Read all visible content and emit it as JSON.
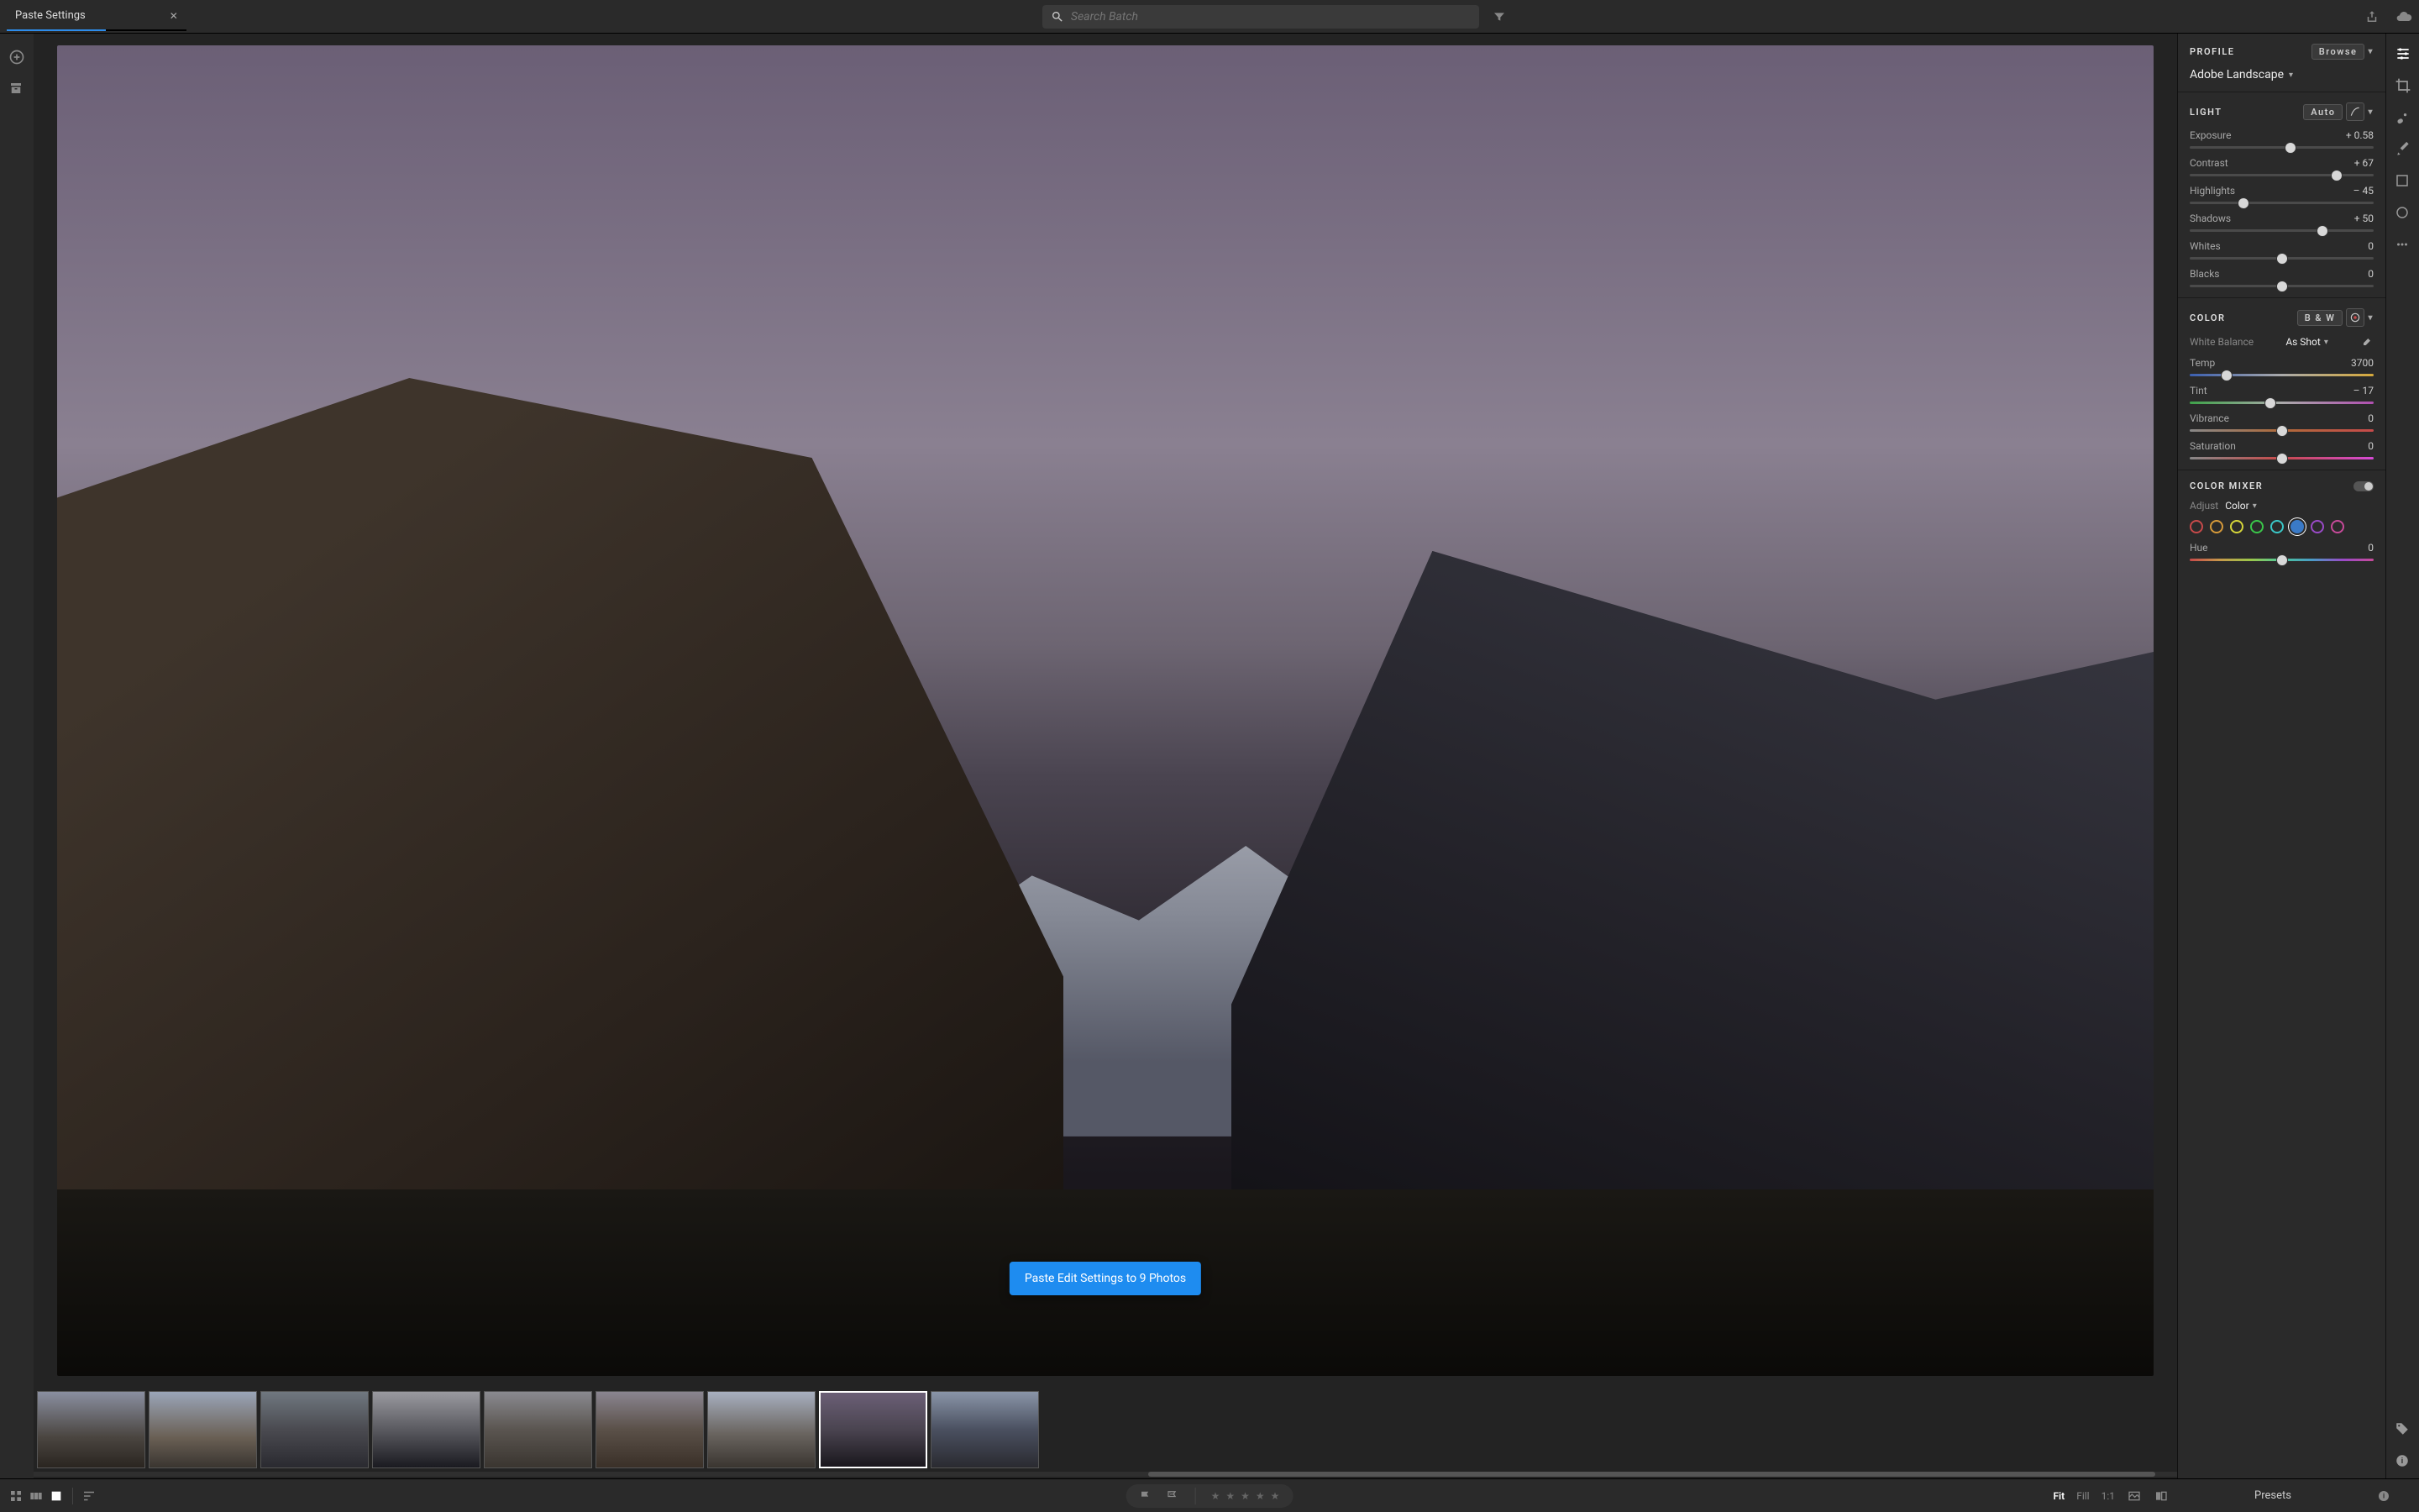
{
  "topbar": {
    "tab_title": "Paste Settings",
    "search_placeholder": "Search Batch"
  },
  "toast": {
    "message": "Paste Edit Settings to 9 Photos"
  },
  "profile": {
    "section_label": "PROFILE",
    "browse": "Browse",
    "name": "Adobe Landscape"
  },
  "light": {
    "section_label": "LIGHT",
    "auto": "Auto",
    "sliders": {
      "exposure": {
        "label": "Exposure",
        "value": "+ 0.58",
        "pos": 55
      },
      "contrast": {
        "label": "Contrast",
        "value": "+ 67",
        "pos": 80
      },
      "highlights": {
        "label": "Highlights",
        "value": "– 45",
        "pos": 29
      },
      "shadows": {
        "label": "Shadows",
        "value": "+ 50",
        "pos": 72
      },
      "whites": {
        "label": "Whites",
        "value": "0",
        "pos": 50
      },
      "blacks": {
        "label": "Blacks",
        "value": "0",
        "pos": 50
      }
    }
  },
  "color": {
    "section_label": "COLOR",
    "bw": "B & W",
    "white_balance_label": "White Balance",
    "white_balance_value": "As Shot",
    "sliders": {
      "temp": {
        "label": "Temp",
        "value": "3700",
        "pos": 20
      },
      "tint": {
        "label": "Tint",
        "value": "– 17",
        "pos": 44
      },
      "vibrance": {
        "label": "Vibrance",
        "value": "0",
        "pos": 50
      },
      "saturation": {
        "label": "Saturation",
        "value": "0",
        "pos": 50
      }
    }
  },
  "mixer": {
    "section_label": "COLOR MIXER",
    "adjust_label": "Adjust",
    "adjust_value": "Color",
    "swatches": [
      "#c74a4a",
      "#d69a3a",
      "#d6d63a",
      "#3ac74a",
      "#3ac7c7",
      "#3a7ac7",
      "#9a4ac7",
      "#c74a9a"
    ],
    "selected_index": 5,
    "hue": {
      "label": "Hue",
      "value": "0",
      "pos": 50
    }
  },
  "bottombar": {
    "zoom": {
      "fit": "Fit",
      "fill": "Fill",
      "one": "1:1"
    },
    "presets": "Presets"
  },
  "thumbnails": {
    "count": 9,
    "selected_index": 7
  }
}
